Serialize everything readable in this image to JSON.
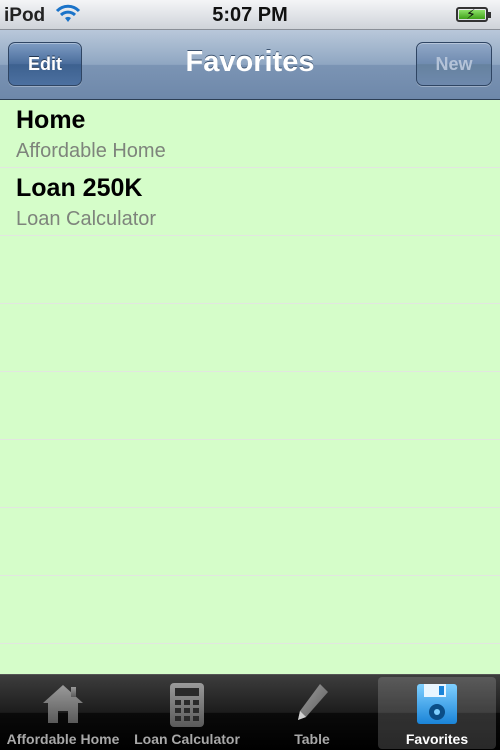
{
  "status_bar": {
    "carrier": "iPod",
    "time": "5:07 PM"
  },
  "nav": {
    "title": "Favorites",
    "left_button": "Edit",
    "right_button": "New"
  },
  "favorites": [
    {
      "title": "Home",
      "subtitle": "Affordable Home"
    },
    {
      "title": "Loan 250K",
      "subtitle": "Loan Calculator"
    }
  ],
  "tabs": [
    {
      "label": "Affordable Home",
      "icon": "house-icon"
    },
    {
      "label": "Loan Calculator",
      "icon": "calculator-icon"
    },
    {
      "label": "Table",
      "icon": "pencil-icon"
    },
    {
      "label": "Favorites",
      "icon": "floppy-disk-icon",
      "selected": true
    }
  ],
  "colors": {
    "list_background": "#d5fdc9",
    "nav_blue": "#6e88aa",
    "tab_active": "#2fa0ee"
  }
}
